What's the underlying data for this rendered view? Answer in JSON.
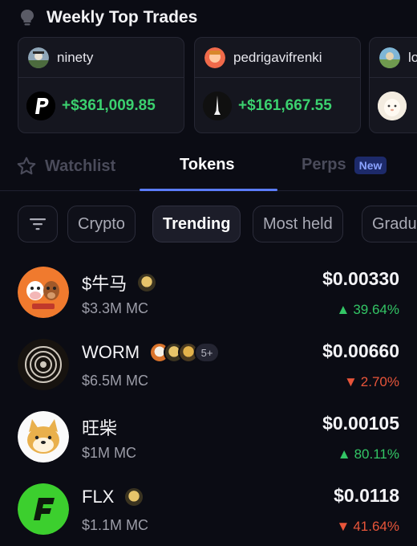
{
  "header": {
    "title": "Weekly Top Trades",
    "icon": "lightbulb-icon"
  },
  "top_trades": [
    {
      "username": "ninety",
      "pnl": "+$361,009.85",
      "token_icon": "paypal-p-icon"
    },
    {
      "username": "pedrigavifrenki",
      "pnl": "+$161,667.55",
      "token_icon": "spire-icon"
    },
    {
      "username": "lo",
      "pnl": "",
      "token_icon": "white-creature-icon"
    }
  ],
  "tabs": [
    {
      "label": "Watchlist",
      "icon": "star-outline-icon"
    },
    {
      "label": "Tokens"
    },
    {
      "label": "Perps",
      "badge": "New"
    }
  ],
  "filters": {
    "icon": "filter-lines-icon",
    "chips": [
      "Crypto",
      "Trending",
      "Most held",
      "Gradu"
    ],
    "selected": "Trending"
  },
  "tokens": [
    {
      "name": "$牛马",
      "mc": "$3.3M MC",
      "price": "$0.00330",
      "change": "39.64%",
      "direction": "up",
      "holders_more": ""
    },
    {
      "name": "WORM",
      "mc": "$6.5M MC",
      "price": "$0.00660",
      "change": "2.70%",
      "direction": "down",
      "holders_more": "5+"
    },
    {
      "name": "旺柴",
      "mc": "$1M MC",
      "price": "$0.00105",
      "change": "80.11%",
      "direction": "up",
      "holders_more": ""
    },
    {
      "name": "FLX",
      "mc": "$1.1M MC",
      "price": "$0.0118",
      "change": "41.64%",
      "direction": "down",
      "holders_more": ""
    }
  ],
  "colors": {
    "up": "#33c565",
    "down": "#e8553a",
    "accent": "#5b7cfa",
    "pnl": "#3bd16f"
  }
}
